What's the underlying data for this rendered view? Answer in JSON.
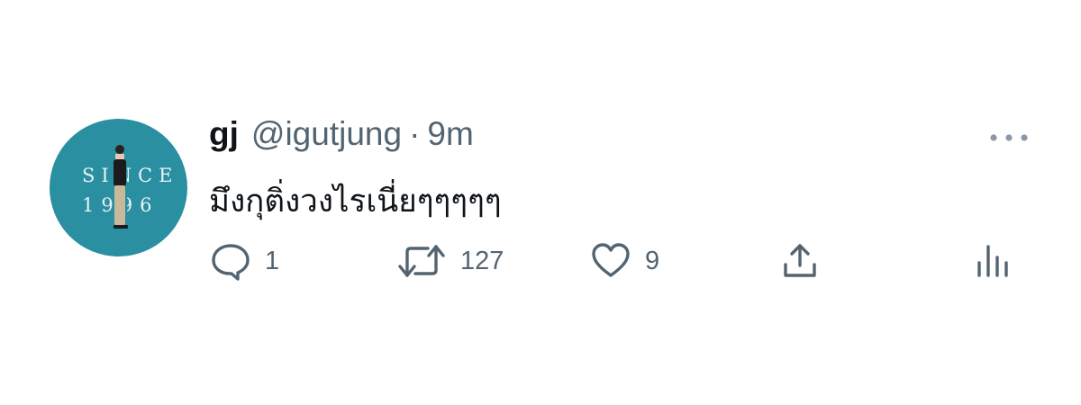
{
  "tweet": {
    "display_name": "gj",
    "handle": "@igutjung",
    "separator": "·",
    "time": "9m",
    "text": "มึงกุติ่งวงไรเนี่ยๆๆๆๆๆ",
    "avatar": {
      "line1": "SINCE",
      "line2": "1996",
      "background": "#2a8fa1"
    },
    "actions": {
      "reply_count": "1",
      "retweet_count": "127",
      "like_count": "9"
    }
  },
  "icons": [
    "reply-icon",
    "retweet-icon",
    "like-icon",
    "share-icon",
    "analytics-icon",
    "more-icon"
  ],
  "colors": {
    "text_primary": "#0f1419",
    "text_secondary": "#536471"
  }
}
